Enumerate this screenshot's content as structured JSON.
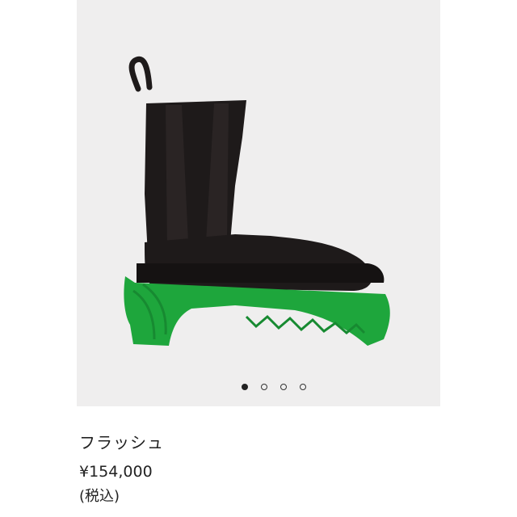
{
  "product": {
    "image_icon": "green-sole-chelsea-boot-image",
    "name": "フラッシュ",
    "price": "¥154,000",
    "tax_note": "(税込)"
  },
  "carousel": {
    "count": 4,
    "active_index": 0
  },
  "colors": {
    "gallery_background": "#efeeee",
    "boot_leather": "#1e1a1a",
    "sole_green": "#1ea63c"
  }
}
